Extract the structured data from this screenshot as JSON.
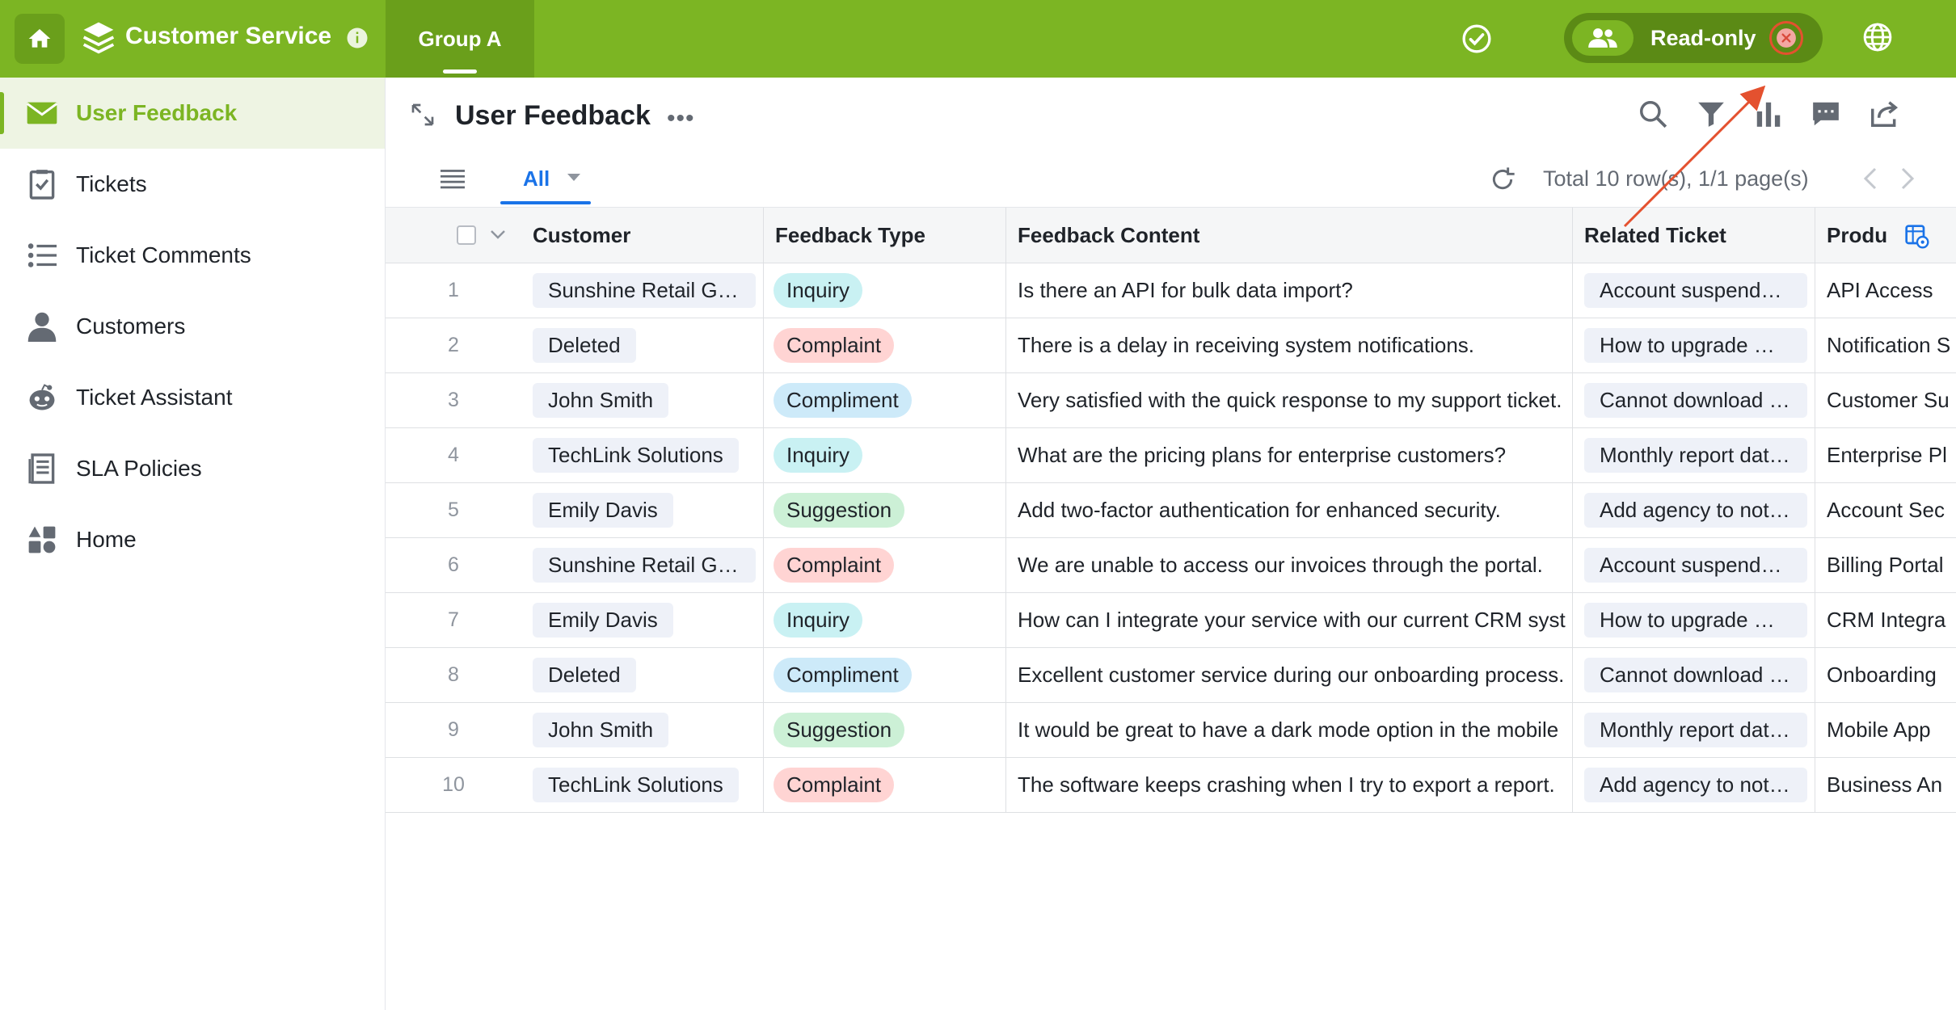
{
  "app": {
    "title": "Customer Service",
    "group_tab": "Group A",
    "readonly_label": "Read-only"
  },
  "sidebar": {
    "items": [
      {
        "label": "User Feedback",
        "icon": "envelope-icon",
        "active": true
      },
      {
        "label": "Tickets",
        "icon": "checklist-icon"
      },
      {
        "label": "Ticket Comments",
        "icon": "list-icon"
      },
      {
        "label": "Customers",
        "icon": "person-icon"
      },
      {
        "label": "Ticket Assistant",
        "icon": "robot-icon"
      },
      {
        "label": "SLA Policies",
        "icon": "document-icon"
      },
      {
        "label": "Home",
        "icon": "dashboard-icon"
      }
    ]
  },
  "view": {
    "title": "User Feedback",
    "tab_all": "All",
    "total": "Total 10 row(s), 1/1 page(s)"
  },
  "table": {
    "columns": [
      "Customer",
      "Feedback Type",
      "Feedback Content",
      "Related Ticket",
      "Produ"
    ],
    "rows": [
      {
        "n": "1",
        "customer": "Sunshine Retail Gro…",
        "type": "Inquiry",
        "content": "Is there an API for bulk data import?",
        "ticket": "Account suspended…",
        "product": "API Access"
      },
      {
        "n": "2",
        "customer": "Deleted",
        "type": "Complaint",
        "content": "There is a delay in receiving system notifications.",
        "ticket": "How to upgrade my…",
        "product": "Notification S"
      },
      {
        "n": "3",
        "customer": "John Smith",
        "type": "Compliment",
        "content": "Very satisfied with the quick response to my support ticket.",
        "ticket": "Cannot download a…",
        "product": "Customer Su"
      },
      {
        "n": "4",
        "customer": "TechLink Solutions",
        "type": "Inquiry",
        "content": "What are the pricing plans for enterprise customers?",
        "ticket": "Monthly report data…",
        "product": "Enterprise Pl"
      },
      {
        "n": "5",
        "customer": "Emily Davis",
        "type": "Suggestion",
        "content": "Add two-factor authentication for enhanced security.",
        "ticket": "Add agency to notifi…",
        "product": "Account Sec"
      },
      {
        "n": "6",
        "customer": "Sunshine Retail Gro…",
        "type": "Complaint",
        "content": "We are unable to access our invoices through the portal.",
        "ticket": "Account suspended…",
        "product": "Billing Portal"
      },
      {
        "n": "7",
        "customer": "Emily Davis",
        "type": "Inquiry",
        "content": "How can I integrate your service with our current CRM syst",
        "ticket": "How to upgrade my…",
        "product": "CRM Integra"
      },
      {
        "n": "8",
        "customer": "Deleted",
        "type": "Compliment",
        "content": "Excellent customer service during our onboarding process.",
        "ticket": "Cannot download a…",
        "product": "Onboarding"
      },
      {
        "n": "9",
        "customer": "John Smith",
        "type": "Suggestion",
        "content": "It would be great to have a dark mode option in the mobile",
        "ticket": "Monthly report data…",
        "product": "Mobile App"
      },
      {
        "n": "10",
        "customer": "TechLink Solutions",
        "type": "Complaint",
        "content": "The software keeps crashing when I try to export a report.",
        "ticket": "Add agency to notifi…",
        "product": "Business An"
      }
    ]
  },
  "colors": {
    "brand": "#7cb523",
    "Inquiry": "#c9f1f3",
    "Complaint": "#ffd4d3",
    "Compliment": "#cdeaf9",
    "Suggestion": "#ccf0d6",
    "annotation": "#e4512f"
  }
}
